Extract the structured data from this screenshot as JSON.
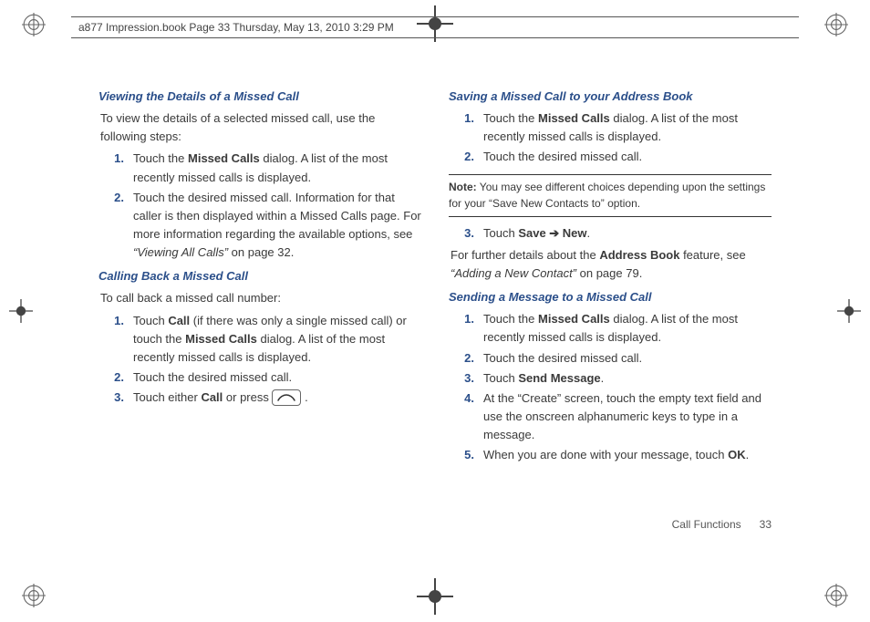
{
  "header": "a877 Impression.book  Page 33  Thursday, May 13, 2010  3:29 PM",
  "left": {
    "sec1": {
      "title": "Viewing the Details of a Missed Call",
      "intro": "To view the details of a selected missed call, use the following steps:",
      "s1": {
        "num": "1.",
        "pre": "Touch the ",
        "b": "Missed Calls",
        "post": " dialog. A list of the most recently missed calls is displayed."
      },
      "s2": {
        "num": "2.",
        "pre": "Touch the desired missed call. Information for that caller is then displayed within a Missed Calls page. For more information regarding the available options, see ",
        "ref": "“Viewing All Calls”",
        "post": " on page 32."
      }
    },
    "sec2": {
      "title": "Calling Back a Missed Call",
      "intro": "To call back a missed call number:",
      "s1": {
        "num": "1.",
        "pre": "Touch ",
        "b1": "Call",
        "mid": " (if there was only a single missed call) or touch the ",
        "b2": "Missed Calls",
        "post": " dialog. A list of the most recently missed calls is displayed."
      },
      "s2": {
        "num": "2.",
        "text": "Touch the desired missed call."
      },
      "s3": {
        "num": "3.",
        "pre": "Touch either ",
        "b": "Call",
        "mid": " or press ",
        "post": " ."
      }
    }
  },
  "right": {
    "sec1": {
      "title": "Saving a Missed Call to your Address Book",
      "s1": {
        "num": "1.",
        "pre": "Touch the ",
        "b": "Missed Calls",
        "post": " dialog. A list of the most recently missed calls is displayed."
      },
      "s2": {
        "num": "2.",
        "text": "Touch the desired missed call."
      }
    },
    "note": {
      "label": "Note:",
      "text": " You may see different choices depending upon the settings for your “Save New Contacts to” option."
    },
    "sec1b": {
      "s3": {
        "num": "3.",
        "pre": "Touch ",
        "b": "Save ➔ New",
        "post": "."
      }
    },
    "ref1": {
      "pre": "For further details about the ",
      "b": "Address Book",
      "mid": " feature, see ",
      "ref": "“Adding a New Contact”",
      "post": " on page 79."
    },
    "sec2": {
      "title": "Sending a Message to a Missed Call",
      "s1": {
        "num": "1.",
        "pre": "Touch the ",
        "b": "Missed Calls",
        "post": " dialog. A list of the most recently missed calls is displayed."
      },
      "s2": {
        "num": "2.",
        "text": "Touch the desired missed call."
      },
      "s3": {
        "num": "3.",
        "pre": "Touch ",
        "b": "Send Message",
        "post": "."
      },
      "s4": {
        "num": "4.",
        "text": "At the “Create” screen, touch the empty text field and use the onscreen alphanumeric keys to type in a message."
      },
      "s5": {
        "num": "5.",
        "pre": "When you are done with your message, touch ",
        "b": "OK",
        "post": "."
      }
    }
  },
  "footer": {
    "section": "Call Functions",
    "page": "33"
  }
}
